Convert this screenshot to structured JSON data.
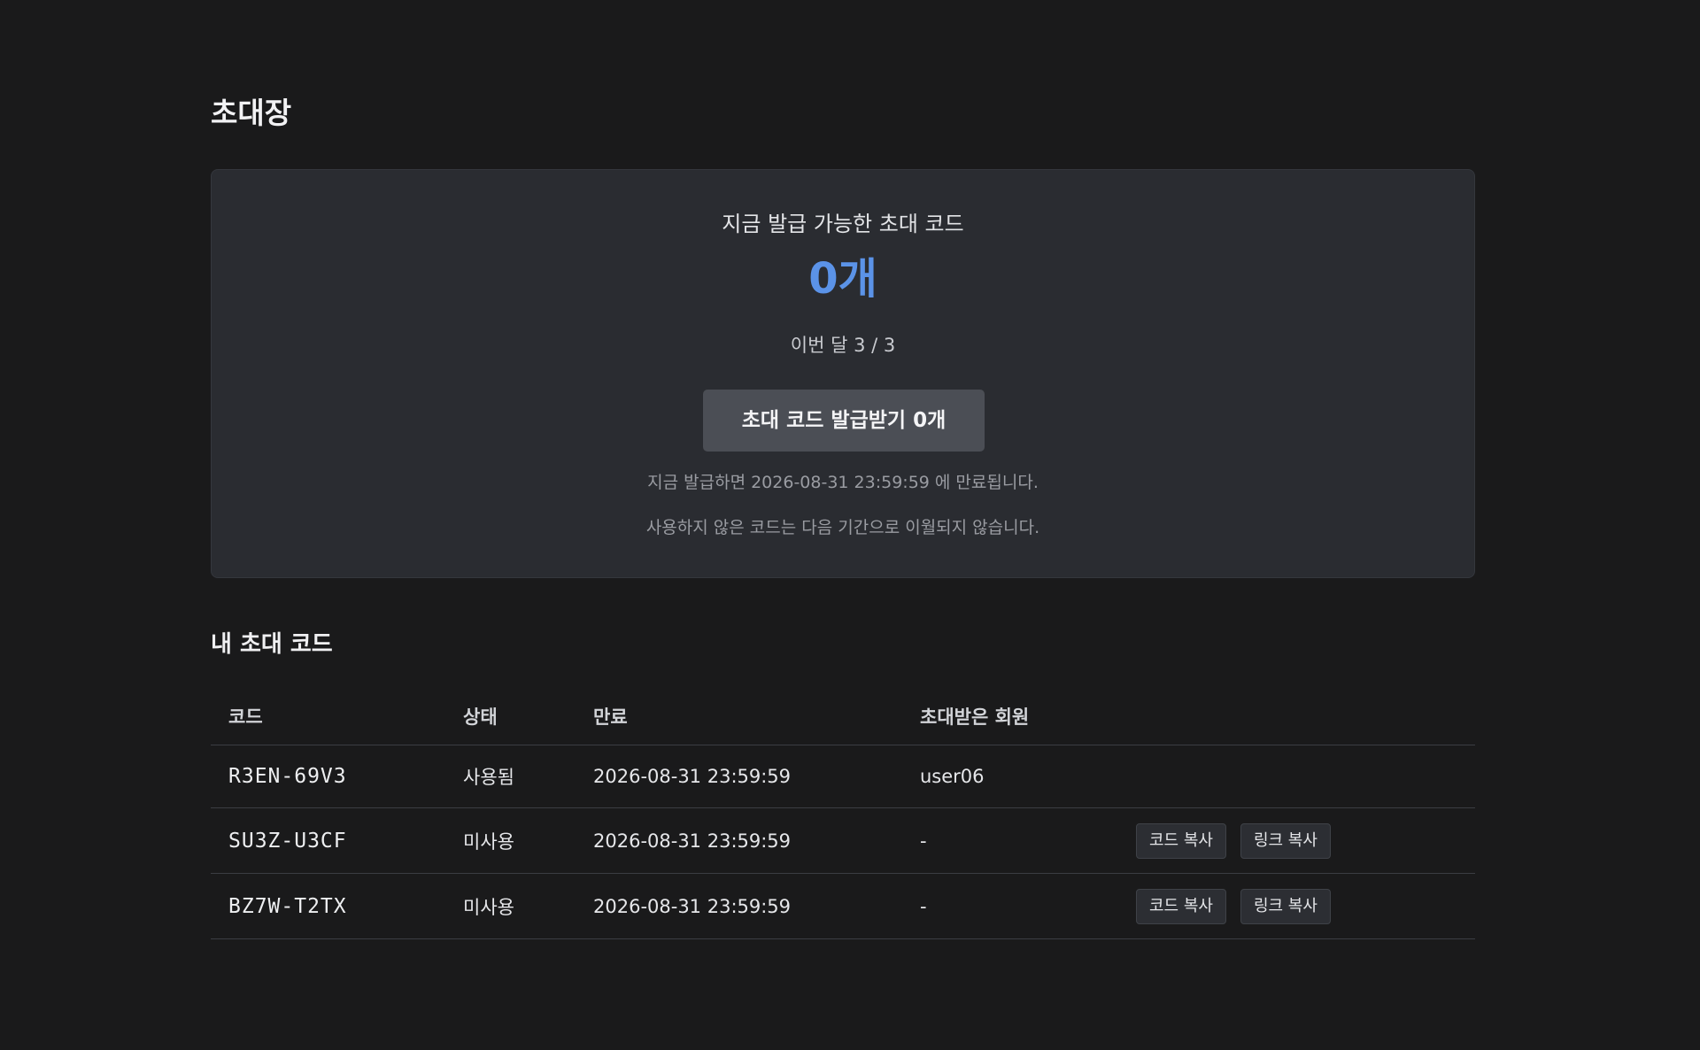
{
  "page": {
    "title": "초대장"
  },
  "card": {
    "label": "지금 발급 가능한 초대 코드",
    "count": "0개",
    "month_usage": "이번 달 3 / 3",
    "issue_button": "초대 코드 발급받기 0개",
    "note_expire": "지금 발급하면 2026-08-31 23:59:59 에 만료됩니다.",
    "note_carryover": "사용하지 않은 코드는 다음 기간으로 이월되지 않습니다.",
    "accent_color": "#5b93e8"
  },
  "codes_section": {
    "title": "내 초대 코드",
    "columns": [
      "코드",
      "상태",
      "만료",
      "초대받은 회원"
    ],
    "rows": [
      {
        "code": "R3EN-69V3",
        "status": "사용됨",
        "expires": "2026-08-31 23:59:59",
        "member": "user06",
        "copy_code": "",
        "copy_link": ""
      },
      {
        "code": "SU3Z-U3CF",
        "status": "미사용",
        "expires": "2026-08-31 23:59:59",
        "member": "-",
        "copy_code": "코드 복사",
        "copy_link": "링크 복사"
      },
      {
        "code": "BZ7W-T2TX",
        "status": "미사용",
        "expires": "2026-08-31 23:59:59",
        "member": "-",
        "copy_code": "코드 복사",
        "copy_link": "링크 복사"
      }
    ]
  }
}
